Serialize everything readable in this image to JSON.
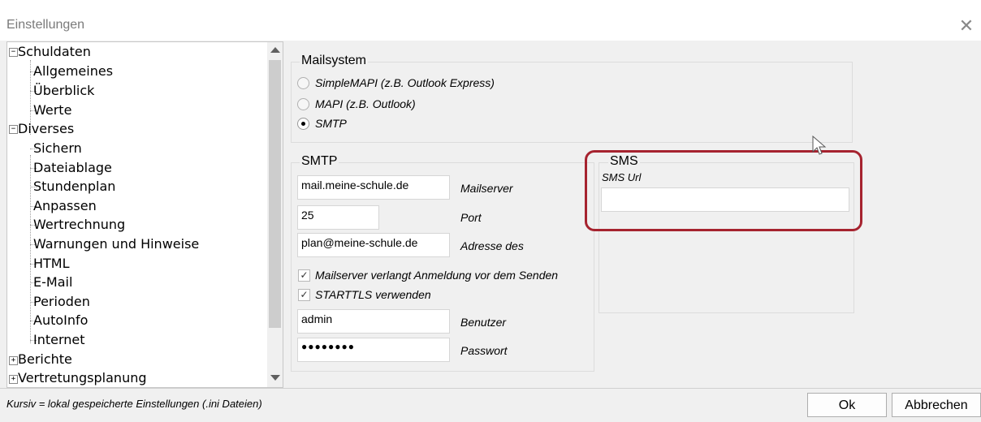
{
  "window": {
    "title": "Einstellungen",
    "close_glyph": "✕"
  },
  "tree": {
    "nodes": [
      {
        "label": "Schuldaten",
        "expander": "−"
      },
      {
        "label": "Allgemeines"
      },
      {
        "label": "Überblick"
      },
      {
        "label": "Werte"
      },
      {
        "label": "Diverses",
        "expander": "−"
      },
      {
        "label": "Sichern"
      },
      {
        "label": "Dateiablage"
      },
      {
        "label": "Stundenplan"
      },
      {
        "label": "Anpassen"
      },
      {
        "label": "Wertrechnung"
      },
      {
        "label": "Warnungen und Hinweise"
      },
      {
        "label": "HTML"
      },
      {
        "label": "E-Mail"
      },
      {
        "label": "Perioden"
      },
      {
        "label": "AutoInfo"
      },
      {
        "label": "Internet"
      },
      {
        "label": "Berichte",
        "expander": "+"
      },
      {
        "label": "Vertretungsplanung",
        "expander": "+"
      }
    ]
  },
  "mailsystem": {
    "title": "Mailsystem",
    "options": [
      {
        "label": "SimpleMAPI (z.B. Outlook Express)",
        "selected": false
      },
      {
        "label": "MAPI (z.B. Outlook)",
        "selected": false
      },
      {
        "label": "SMTP",
        "selected": true
      }
    ]
  },
  "smtp": {
    "title": "SMTP",
    "mailserver_value": "mail.meine-schule.de",
    "mailserver_label": "Mailserver",
    "port_value": "25",
    "port_label": "Port",
    "address_value": "plan@meine-schule.de",
    "address_label": "Adresse des",
    "auth_label": "Mailserver verlangt Anmeldung vor dem Senden",
    "auth_checked": true,
    "starttls_label": "STARTTLS verwenden",
    "starttls_checked": true,
    "user_value": "admin",
    "user_label": "Benutzer",
    "password_value": "●●●●●●●●",
    "password_label": "Passwort"
  },
  "sms": {
    "title": "SMS",
    "url_label": "SMS Url",
    "url_value": ""
  },
  "status": {
    "text": "Kursiv = lokal gespeicherte Einstellungen (.ini Dateien)"
  },
  "buttons": {
    "ok": "Ok",
    "cancel": "Abbrechen"
  },
  "colors": {
    "highlight": "#a6232f",
    "selected_tree_text": "#000000"
  }
}
